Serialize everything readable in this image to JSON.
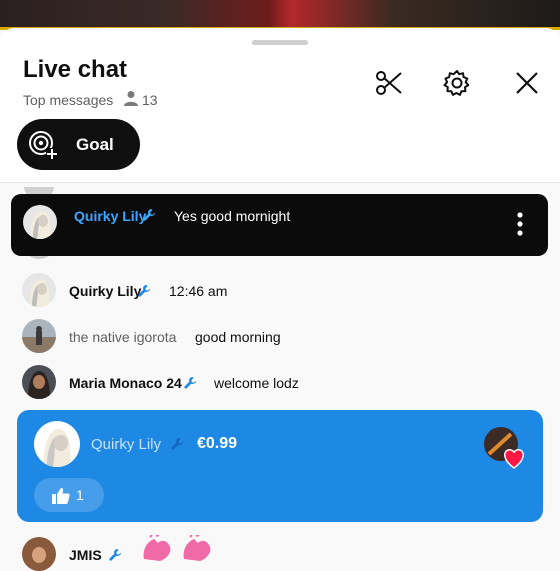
{
  "header": {
    "title": "Live chat",
    "subtitle": "Top messages",
    "viewer_count": "13",
    "icons": [
      "scissors-icon",
      "gear-icon",
      "close-icon"
    ]
  },
  "goal_button": {
    "label": "Goal",
    "icon": "goal-add-icon"
  },
  "pinned": {
    "author": "Quirky Lily",
    "text": "Yes good mornight",
    "menu_icon": "more-vert-icon"
  },
  "messages": [
    {
      "author": "Quirky Lily",
      "text": "12:46 am",
      "moderator": true,
      "name_color": "#1565c0"
    },
    {
      "author": "the native igorota",
      "text": "good morning",
      "moderator": false,
      "name_color": "#606060"
    },
    {
      "author": "Maria Monaco 24",
      "text": "welcome lodz",
      "moderator": true,
      "name_color": "#1565c0"
    },
    {
      "author": "JMIS",
      "text": "",
      "moderator": true,
      "name_color": "#1565c0"
    }
  ],
  "super_chat": {
    "author": "Quirky Lily",
    "amount": "€0.99",
    "likes": "1",
    "color": "#1e88e5"
  },
  "colors": {
    "accent_blue": "#1e88e5",
    "name_blue": "#1565c0",
    "gold": "#d8a900"
  }
}
